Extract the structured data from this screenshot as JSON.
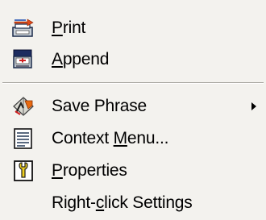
{
  "menu": {
    "items": [
      {
        "label": "Print",
        "mnemonic_index": 0,
        "icon": "print-icon",
        "has_submenu": false
      },
      {
        "label": "Append",
        "mnemonic_index": 0,
        "icon": "append-icon",
        "has_submenu": false
      },
      {
        "label": "Save Phrase",
        "mnemonic_index": -1,
        "icon": "save-phrase-icon",
        "has_submenu": true
      },
      {
        "label": "Context Menu...",
        "mnemonic_index": 8,
        "icon": "context-menu-icon",
        "has_submenu": false
      },
      {
        "label": "Properties",
        "mnemonic_index": 0,
        "icon": "properties-icon",
        "has_submenu": false
      },
      {
        "label": "Right-click Settings",
        "mnemonic_index": 6,
        "icon": "",
        "has_submenu": false
      }
    ]
  },
  "colors": {
    "menu_background": "#f3f2ee",
    "text": "#000000",
    "separator_shadow": "#a7a6a0",
    "separator_highlight": "#ffffff"
  }
}
